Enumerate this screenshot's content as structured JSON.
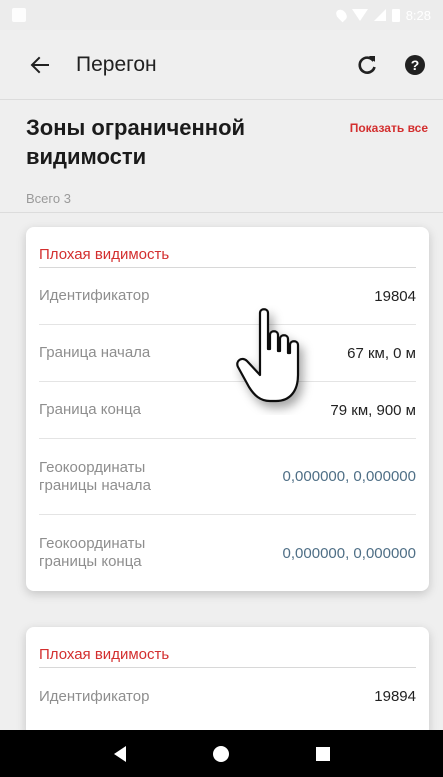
{
  "status_bar": {
    "time": "8:28"
  },
  "app_bar": {
    "title": "Перегон"
  },
  "header": {
    "title": "Зоны ограниченной видимости",
    "show_all": "Показать все",
    "total": "Всего 3"
  },
  "cards": [
    {
      "title": "Плохая видимость",
      "rows": [
        {
          "label": "Идентификатор",
          "value": "19804"
        },
        {
          "label": "Граница начала",
          "value": "67 км, 0 м"
        },
        {
          "label": "Граница конца",
          "value": "79 км, 900 м"
        },
        {
          "label": "Геокоординаты границы начала",
          "value": "0,000000, 0,000000"
        },
        {
          "label": "Геокоординаты границы конца",
          "value": "0,000000, 0,000000"
        }
      ]
    },
    {
      "title": "Плохая видимость",
      "rows": [
        {
          "label": "Идентификатор",
          "value": "19894"
        }
      ]
    }
  ],
  "colors": {
    "accent": "#d32f2f",
    "geo_value": "#4f6f86",
    "background": "#efefef"
  },
  "icons": {
    "back": "arrow-left-icon",
    "refresh": "refresh-icon",
    "help": "help-circle-icon",
    "nav_back": "nav-back-icon",
    "nav_home": "nav-home-icon",
    "nav_recent": "nav-recent-icon"
  }
}
